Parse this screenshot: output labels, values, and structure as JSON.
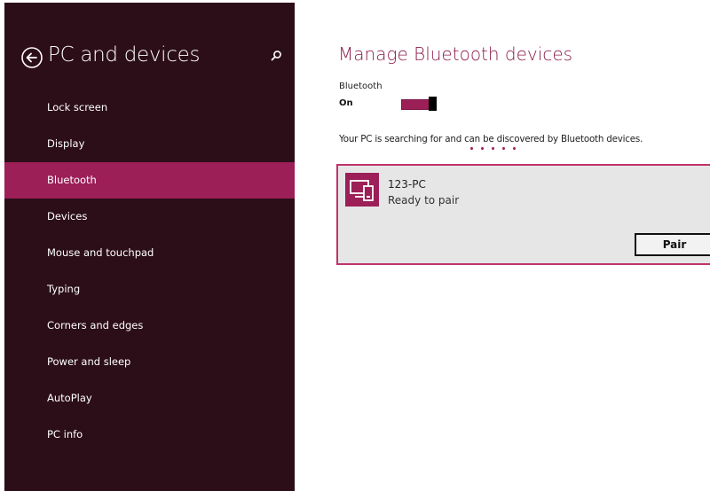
{
  "sidebar": {
    "title": "PC and devices",
    "back_icon": "back-arrow-circle-icon",
    "search_icon": "search-icon",
    "items": [
      {
        "label": "Lock screen",
        "selected": false
      },
      {
        "label": "Display",
        "selected": false
      },
      {
        "label": "Bluetooth",
        "selected": true
      },
      {
        "label": "Devices",
        "selected": false
      },
      {
        "label": "Mouse and touchpad",
        "selected": false
      },
      {
        "label": "Typing",
        "selected": false
      },
      {
        "label": "Corners and edges",
        "selected": false
      },
      {
        "label": "Power and sleep",
        "selected": false
      },
      {
        "label": "AutoPlay",
        "selected": false
      },
      {
        "label": "PC info",
        "selected": false
      }
    ]
  },
  "main": {
    "title": "Manage Bluetooth devices",
    "bluetooth_label": "Bluetooth",
    "bluetooth_state": "On",
    "bluetooth_on": true,
    "status_text": "Your PC is searching for and can be discovered by Bluetooth devices.",
    "device": {
      "name": "123-PC",
      "status": "Ready to pair",
      "icon": "pc-device-icon",
      "pair_label": "Pair"
    }
  },
  "colors": {
    "sidebar_bg": "#2c0e18",
    "accent": "#9c1f58",
    "title_color": "#8a1e4c",
    "card_bg": "#e6e6e6"
  }
}
